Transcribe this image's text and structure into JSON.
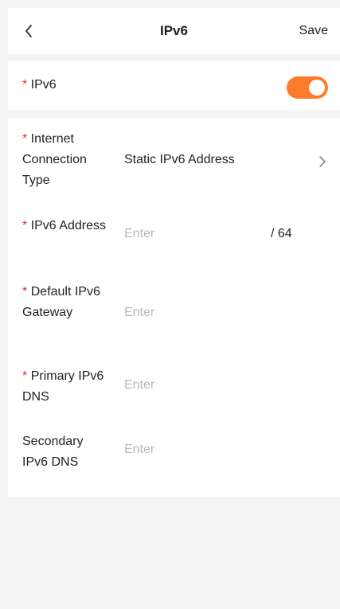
{
  "header": {
    "title": "IPv6",
    "save_label": "Save",
    "back_icon": "chevron-left-icon"
  },
  "ipv6_toggle": {
    "required_mark": "*",
    "label": "IPv6",
    "enabled": true,
    "color": "#ff7a2a"
  },
  "fields": {
    "connection_type": {
      "required_mark": "*",
      "label": "Internet Connection Type",
      "value": "Static IPv6 Address"
    },
    "ipv6_address": {
      "required_mark": "*",
      "label": "IPv6 Address",
      "placeholder": "Enter",
      "suffix": "/ 64"
    },
    "default_gateway": {
      "required_mark": "*",
      "label": "Default IPv6 Gateway",
      "placeholder": "Enter"
    },
    "primary_dns": {
      "required_mark": "*",
      "label": "Primary IPv6 DNS",
      "placeholder": "Enter"
    },
    "secondary_dns": {
      "label": "Secondary IPv6 DNS",
      "placeholder": "Enter"
    }
  },
  "colors": {
    "accent": "#ff7a2a",
    "required": "#e03131",
    "placeholder": "#b9b9b9"
  }
}
